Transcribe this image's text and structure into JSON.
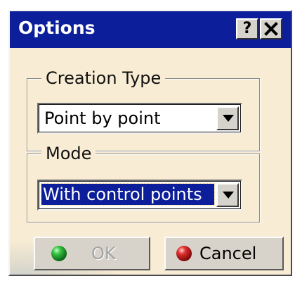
{
  "window": {
    "title": "Options",
    "help_label": "?",
    "close_label": "✕"
  },
  "creation_type": {
    "legend": "Creation Type",
    "selected": "Point by point"
  },
  "mode": {
    "legend": "Mode",
    "selected": "With control points"
  },
  "buttons": {
    "ok_label": "OK",
    "ok_enabled": false,
    "cancel_label": "Cancel"
  },
  "colors": {
    "titlebar": "#0c1e9a",
    "dialog_background": "#f8ecd4",
    "ok_icon": "#1aa52a",
    "cancel_icon": "#d21e1e"
  },
  "icons": {
    "ok": "green-ball-icon",
    "cancel": "red-ball-icon",
    "dropdown": "chevron-down-icon"
  }
}
